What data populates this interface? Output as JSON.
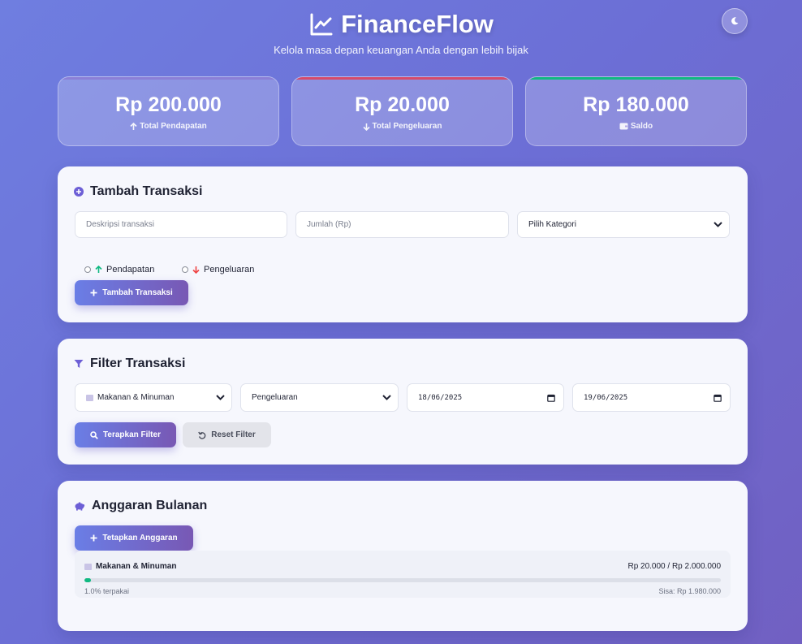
{
  "app": {
    "title": "FinanceFlow",
    "tagline": "Kelola masa depan keuangan Anda dengan lebih bijak",
    "theme_icon": "moon-icon"
  },
  "stats": [
    {
      "amount": "Rp 200.000",
      "label": "Total Pendapatan",
      "icon": "arrow-up-icon",
      "accent": "#8b7fd6"
    },
    {
      "amount": "Rp 20.000",
      "label": "Total Pengeluaran",
      "icon": "arrow-down-icon",
      "accent": "#d64b6a"
    },
    {
      "amount": "Rp 180.000",
      "label": "Saldo",
      "icon": "wallet-icon",
      "accent": "#10b981"
    }
  ],
  "add_transaction": {
    "title": "Tambah Transaksi",
    "description_placeholder": "Deskripsi transaksi",
    "amount_placeholder": "Jumlah (Rp)",
    "category_selected": "Pilih Kategori",
    "income_label": "Pendapatan",
    "expense_label": "Pengeluaran",
    "submit_label": "Tambah Transaksi"
  },
  "filter": {
    "title": "Filter Transaksi",
    "category_selected": "Makanan & Minuman",
    "type_selected": "Pengeluaran",
    "date_from": "18/06/2025",
    "date_to": "19/06/2025",
    "apply_label": "Terapkan Filter",
    "reset_label": "Reset Filter"
  },
  "budget": {
    "title": "Anggaran Bulanan",
    "set_label": "Tetapkan Anggaran",
    "items": [
      {
        "category": "Makanan & Minuman",
        "amounts": "Rp 20.000 / Rp 2.000.000",
        "used_fraction": 0.01,
        "used_text": "1.0% terpakai",
        "remaining_text": "Sisa: Rp 1.980.000"
      }
    ]
  },
  "colors": {
    "income": "#10b981",
    "expense": "#ef4444",
    "primary_start": "#6a7ee6",
    "primary_end": "#7858b4"
  }
}
